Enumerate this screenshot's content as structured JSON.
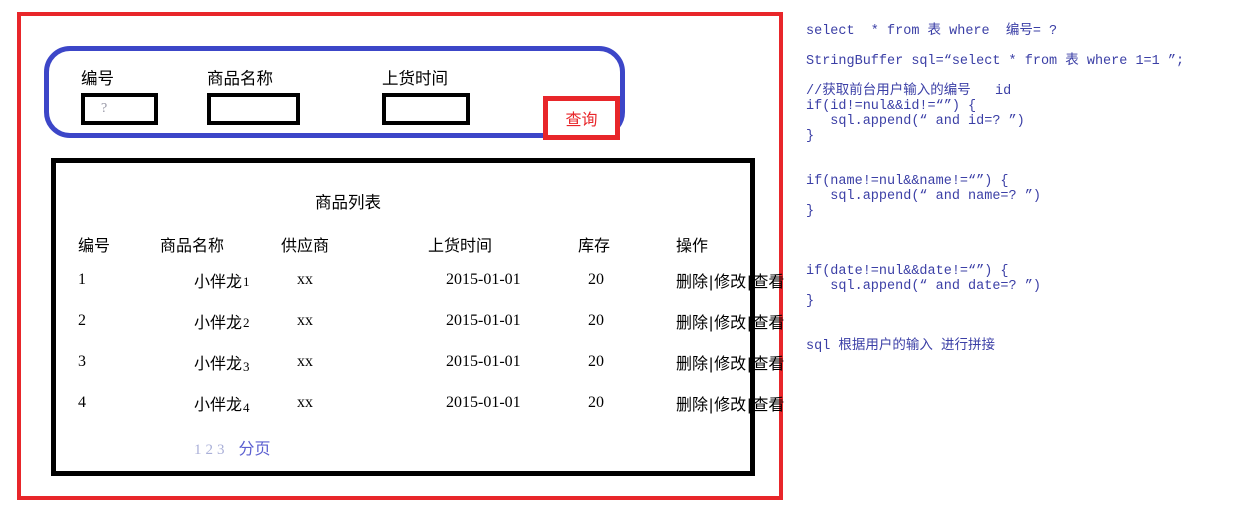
{
  "mockup": {
    "search_panel": {
      "fields": [
        {
          "label": "编号",
          "value": "?",
          "placeholder": ""
        },
        {
          "label": "商品名称",
          "value": "",
          "placeholder": ""
        },
        {
          "label": "上货时间",
          "value": "",
          "placeholder": ""
        }
      ],
      "query_button": "查询"
    },
    "list_panel": {
      "title": "商品列表",
      "columns": [
        "编号",
        "商品名称",
        "供应商",
        "上货时间",
        "库存",
        "操作"
      ],
      "rows": [
        {
          "id": "1",
          "name_base": "小伴龙",
          "name_idx": "1",
          "supplier": "xx",
          "date": "2015-01-01",
          "stock": "20"
        },
        {
          "id": "2",
          "name_base": "小伴龙",
          "name_idx": "2",
          "supplier": "xx",
          "date": "2015-01-01",
          "stock": "20"
        },
        {
          "id": "3",
          "name_base": "小伴龙",
          "name_idx": "3",
          "supplier": "xx",
          "date": "2015-01-01",
          "stock": "20"
        },
        {
          "id": "4",
          "name_base": "小伴龙",
          "name_idx": "4",
          "supplier": "xx",
          "date": "2015-01-01",
          "stock": "20"
        }
      ],
      "actions": {
        "delete": "删除",
        "edit": "修改",
        "view": "查看",
        "separator": "|"
      },
      "pagination": {
        "pages": [
          "1",
          "2",
          "3"
        ],
        "label": "分页"
      }
    },
    "colors": {
      "outer_frame": "#e8262a",
      "search_panel_border": "#3c46c8",
      "query_button": "#e8262a",
      "list_border": "#000000",
      "pagination_label": "#5b5fd0",
      "pagination_number": "#aab0d8"
    }
  },
  "code_notes": {
    "color": "#3b3fa6",
    "lines": [
      "select  * from 表 where  编号= ?",
      "",
      "StringBuffer sql=“select * from 表 where 1=1 ”;",
      "",
      "//获取前台用户输入的编号   id",
      "if(id!=nul&&id!=“”) {",
      "   sql.append(“ and id=? ”)",
      "}",
      "",
      "",
      "if(name!=nul&&name!=“”) {",
      "   sql.append(“ and name=? ”)",
      "}",
      "",
      "",
      "",
      "if(date!=nul&&date!=“”) {",
      "   sql.append(“ and date=? ”)",
      "}",
      "",
      "",
      "sql 根据用户的输入 进行拼接"
    ]
  }
}
